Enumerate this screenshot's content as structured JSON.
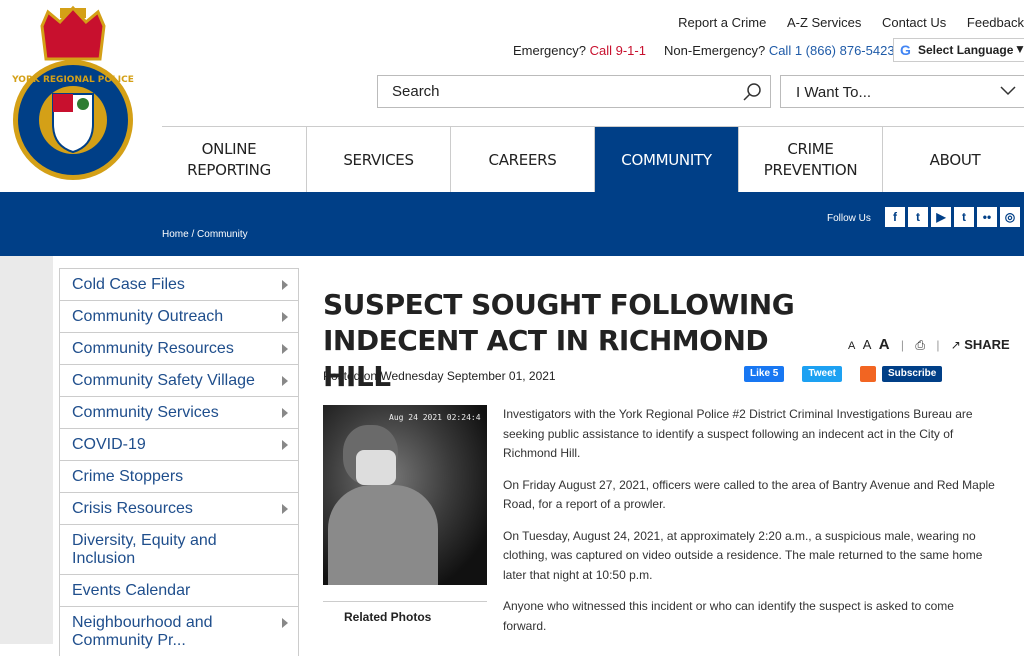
{
  "header": {
    "logo_text": "YORK REGIONAL POLICE",
    "util_links": [
      "Report a Crime",
      "A-Z Services",
      "Contact Us",
      "Feedback"
    ],
    "emergency_label": "Emergency?",
    "emergency_number": "Call 9-1-1",
    "nonemergency_label": "Non-Emergency?",
    "nonemergency_number": "Call 1 (866) 876-5423",
    "language": "Select Language",
    "search_placeholder": "Search",
    "iwant": "I Want To..."
  },
  "nav": [
    {
      "label": "ONLINE REPORTING"
    },
    {
      "label": "SERVICES"
    },
    {
      "label": "CAREERS"
    },
    {
      "label": "COMMUNITY"
    },
    {
      "label": "CRIME PREVENTION"
    },
    {
      "label": "ABOUT"
    }
  ],
  "bluebar": {
    "breadcrumb_home": "Home",
    "breadcrumb_sep": "/",
    "breadcrumb_current": "Community",
    "follow_us": "Follow Us",
    "social": [
      "f",
      "t",
      "▶",
      "t",
      "••",
      "◎"
    ]
  },
  "sidebar": [
    {
      "label": "Cold Case Files",
      "caret": true
    },
    {
      "label": "Community Outreach",
      "caret": true
    },
    {
      "label": "Community Resources",
      "caret": true
    },
    {
      "label": "Community Safety Village",
      "caret": true
    },
    {
      "label": "Community Services",
      "caret": true
    },
    {
      "label": "COVID-19",
      "caret": true
    },
    {
      "label": "Crime Stoppers",
      "caret": false
    },
    {
      "label": "Crisis Resources",
      "caret": true
    },
    {
      "label": "Diversity, Equity and Inclusion",
      "caret": false
    },
    {
      "label": "Events Calendar",
      "caret": false
    },
    {
      "label": "Neighbourhood and Community Pr...",
      "caret": true
    }
  ],
  "article": {
    "title": "SUSPECT SOUGHT FOLLOWING INDECENT ACT IN RICHMOND HILL",
    "text_size_labels": [
      "A",
      "A",
      "A"
    ],
    "share": "SHARE",
    "posted": "Posted on Wednesday September 01, 2021",
    "fb_like": "Like 5",
    "tweet": "Tweet",
    "subscribe": "Subscribe",
    "photo_stamp": "Aug 24 2021  02:24:4",
    "related_photos": "Related Photos",
    "paragraphs": [
      "Investigators with the York Regional Police #2 District Criminal Investigations Bureau are seeking public assistance to identify a suspect following an indecent act in the City of Richmond Hill.",
      "On Friday August 27, 2021, officers were called to the area of Bantry Avenue and Red Maple Road, for a report of a prowler.",
      "On Tuesday, August 24, 2021, at approximately 2:20 a.m., a suspicious male, wearing no clothing, was captured on video outside a residence. The male returned to the same home later that night at 10:50 p.m.",
      "Anyone who witnessed this incident or who can identify the suspect is asked to come forward."
    ]
  },
  "colors": {
    "brand_blue": "#003f87",
    "link_blue": "#1f4e8c",
    "emergency_red": "#c8102e"
  }
}
